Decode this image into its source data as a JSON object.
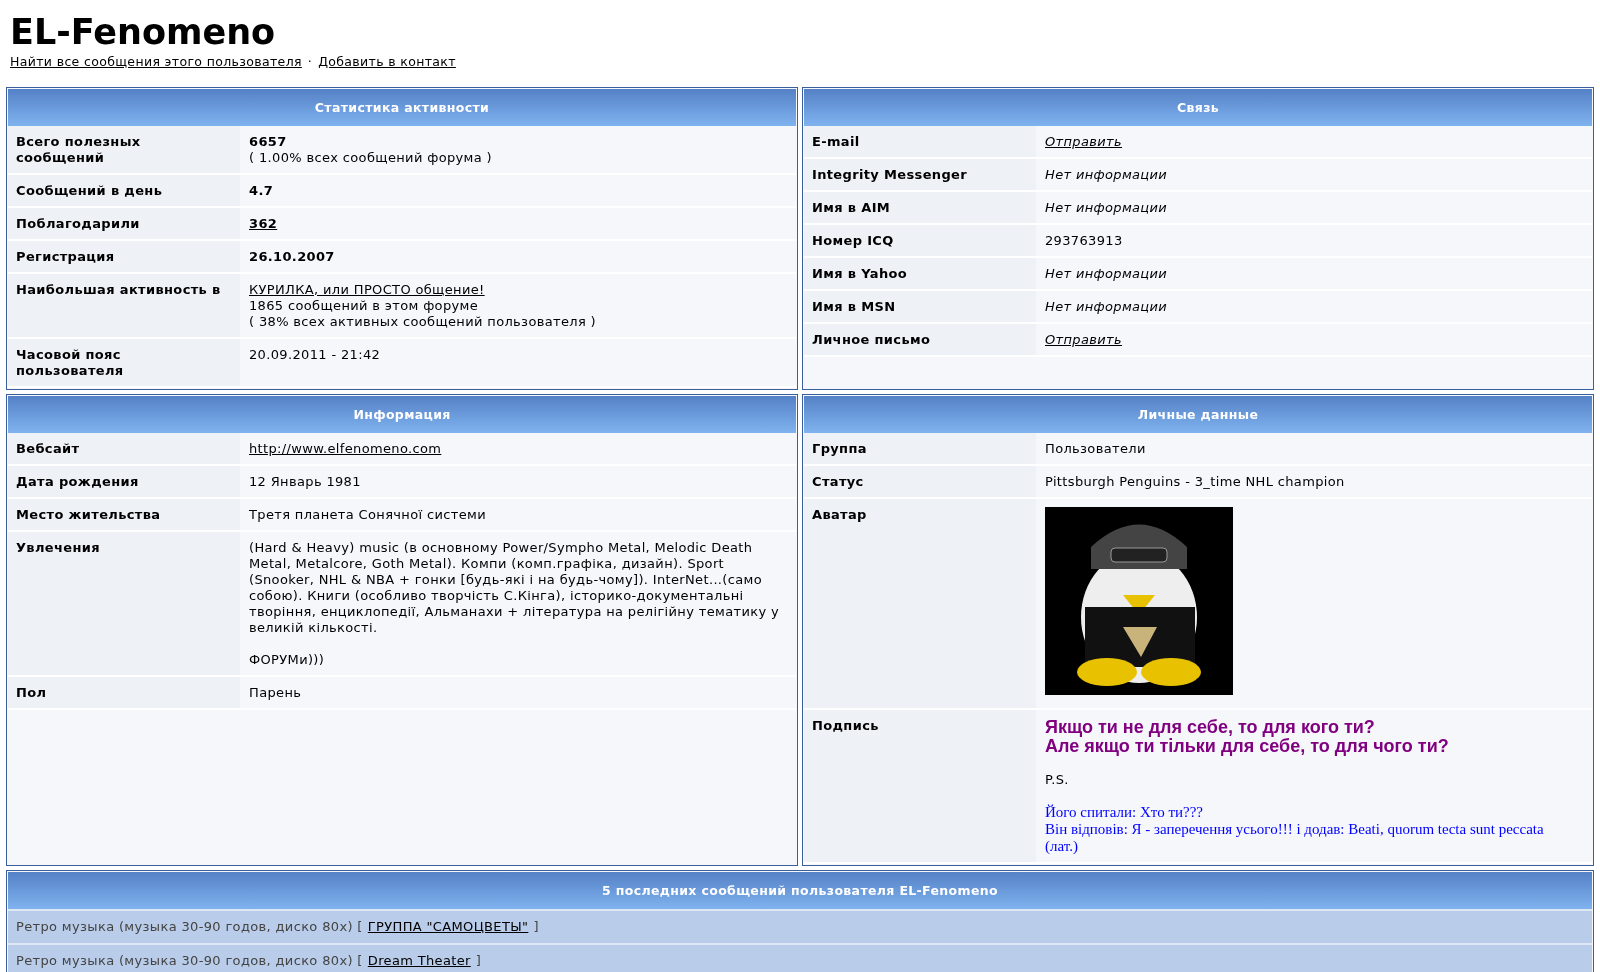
{
  "profile": {
    "username": "EL-Fenomeno",
    "links": [
      {
        "text": "Найти все сообщения этого пользователя"
      },
      {
        "text": "Добавить в контакт"
      }
    ],
    "separator": "·"
  },
  "panels": [
    {
      "title": "Статистика активности",
      "rows": [
        {
          "label": "Всего полезных сообщений",
          "values": [
            {
              "kind": "bold",
              "text": "6657"
            },
            {
              "kind": "plain",
              "text": "( 1.00% всех сообщений форума )"
            }
          ]
        },
        {
          "label": "Сообщений в день",
          "values": [
            {
              "kind": "bold",
              "text": "4.7"
            }
          ]
        },
        {
          "label": "Поблагодарили",
          "values": [
            {
              "kind": "bold_link",
              "text": "362"
            }
          ]
        },
        {
          "label": "Регистрация",
          "values": [
            {
              "kind": "bold",
              "text": "26.10.2007"
            }
          ]
        },
        {
          "label": "Наибольшая активность в",
          "values": [
            {
              "kind": "link",
              "text": "КУРИЛКА, или ПРОСТО общение!"
            },
            {
              "kind": "plain",
              "text": "1865 сообщений в этом форуме"
            },
            {
              "kind": "plain",
              "text": "( 38% всех активных сообщений пользователя )"
            }
          ]
        },
        {
          "label": "Часовой пояс пользователя",
          "values": [
            {
              "kind": "plain",
              "text": "20.09.2011 - 21:42"
            }
          ]
        }
      ]
    },
    {
      "title": "Связь",
      "rows": [
        {
          "label": "E-mail",
          "values": [
            {
              "kind": "italic_link",
              "text": "Отправить"
            }
          ]
        },
        {
          "label": "Integrity Messenger",
          "values": [
            {
              "kind": "italic",
              "text": "Нет информации"
            }
          ]
        },
        {
          "label": "Имя в AIM",
          "values": [
            {
              "kind": "italic",
              "text": "Нет информации"
            }
          ]
        },
        {
          "label": "Номер ICQ",
          "values": [
            {
              "kind": "plain",
              "text": "293763913"
            }
          ]
        },
        {
          "label": "Имя в Yahoo",
          "values": [
            {
              "kind": "italic",
              "text": "Нет информации"
            }
          ]
        },
        {
          "label": "Имя в MSN",
          "values": [
            {
              "kind": "italic",
              "text": "Нет информации"
            }
          ]
        },
        {
          "label": "Личное письмо",
          "values": [
            {
              "kind": "italic_link",
              "text": "Отправить"
            }
          ]
        }
      ]
    },
    {
      "title": "Информация",
      "rows": [
        {
          "label": "Вебсайт",
          "values": [
            {
              "kind": "link",
              "text": "http://www.elfenomeno.com"
            }
          ]
        },
        {
          "label": "Дата рождения",
          "values": [
            {
              "kind": "plain",
              "text": "12 Январь 1981"
            }
          ]
        },
        {
          "label": "Место жительства",
          "values": [
            {
              "kind": "plain",
              "text": "Третя планета Сонячної системи"
            }
          ]
        },
        {
          "label": "Увлечения",
          "values": [
            {
              "kind": "paragraph",
              "text": "(Hard & Heavy) music (в основному Power/Sympho Metal, Melodic Death Metal, Metalcore, Goth Metal). Компи (комп.графіка, дизайн). Sport (Snooker, NHL & NBA + гонки [будь-які і на будь-чому]). InterNet...(само собою). Книги (особливо творчість С.Кінга), історико-документальні творіння, енциклопедії, Альманахи + література на релігійну тематику у великій кількості."
            },
            {
              "kind": "paragraph",
              "text": "ФОРУМи)))"
            }
          ]
        },
        {
          "label": "Пол",
          "values": [
            {
              "kind": "plain",
              "text": "Парень"
            }
          ]
        }
      ]
    },
    {
      "title": "Личные данные",
      "rows": [
        {
          "label": "Группа",
          "values": [
            {
              "kind": "plain",
              "text": "Пользователи"
            }
          ]
        },
        {
          "label": "Статус",
          "values": [
            {
              "kind": "plain",
              "text": "Pittsburgh Penguins - 3_time NHL champion"
            }
          ]
        },
        {
          "label": "Аватар",
          "values": [
            {
              "kind": "avatar"
            }
          ]
        },
        {
          "label": "Подпись",
          "values": [
            {
              "kind": "headline",
              "text": "Якщо ти не для себе, то для кого ти?"
            },
            {
              "kind": "headline",
              "text": "Але якщо ти тільки для себе, то для чого ти?"
            },
            {
              "kind": "paragraph",
              "text": "P.S."
            },
            {
              "kind": "quote",
              "text": "Його спитали: Хто ти???"
            },
            {
              "kind": "quote",
              "text": "Він відповів: Я - заперечення усього!!! і додав: Beati, quorum tecta sunt peccata (лат.)"
            }
          ]
        }
      ]
    }
  ],
  "recent_posts": {
    "title": "5 последних сообщений пользователя EL-Fenomeno",
    "rows": [
      {
        "forum": "Ретро музыка (музыка 30-90 годов, диско 80х) [",
        "topic": "ГРУППА \"САМОЦВЕТЫ\"",
        "close": "]"
      },
      {
        "forum": "Ретро музыка (музыка 30-90 годов, диско 80х) [",
        "topic": "Dream Theater",
        "close": "]"
      }
    ]
  }
}
